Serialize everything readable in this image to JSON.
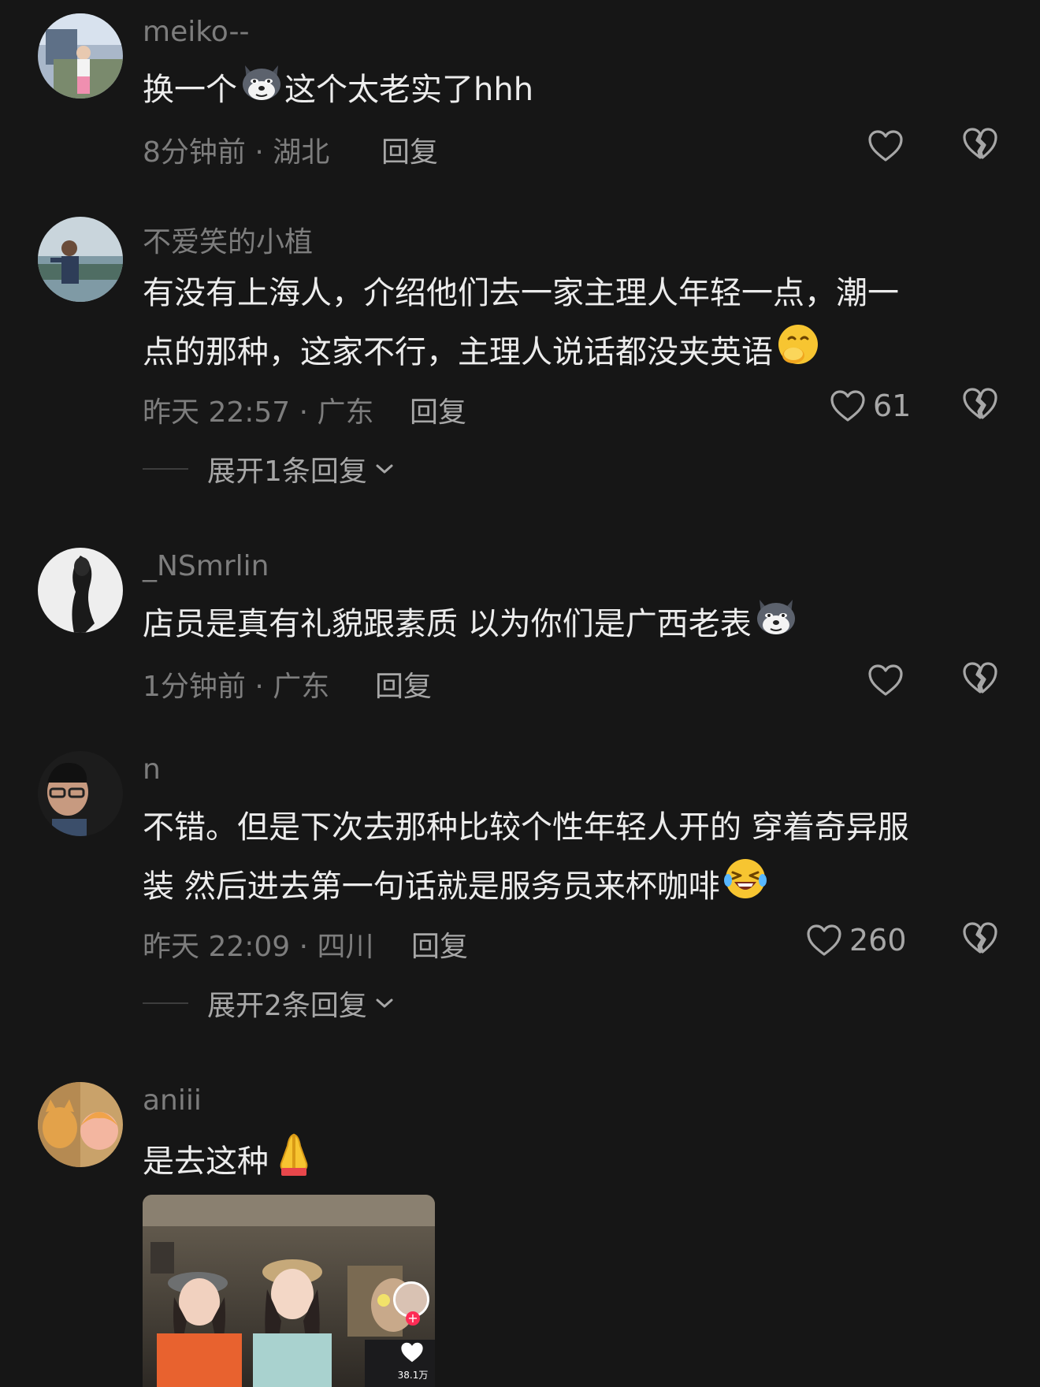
{
  "colors": {
    "background": "#161616",
    "primary_text": "#ececec",
    "secondary_text": "#7d7d7d",
    "action_text": "#a7a7a7"
  },
  "comments": [
    {
      "username": "meiko--",
      "text_lines": [
        "换一个",
        "这个太老实了hhh"
      ],
      "emoji": "husky-sticker",
      "meta": "8分钟前 · 湖北",
      "reply_label": "回复",
      "like_count": "",
      "like_icon": "heart-outline-icon",
      "dislike_icon": "broken-heart-icon"
    },
    {
      "username": "不爱笑的小植",
      "text_lines": [
        "有没有上海人，介绍他们去一家主理人年轻一点，潮一",
        "点的那种，这家不行，主理人说话都没夹英语"
      ],
      "emoji": "covering-mouth-smile-emoji",
      "meta": "昨天 22:57 · 广东",
      "reply_label": "回复",
      "like_count": "61",
      "expand_label": "展开1条回复"
    },
    {
      "username": "_NSmrlin",
      "text_lines": [
        "店员是真有礼貌跟素质  以为你们是广西老表"
      ],
      "emoji": "husky-sticker",
      "meta": "1分钟前 · 广东",
      "reply_label": "回复",
      "like_count": ""
    },
    {
      "username": "n",
      "text_lines": [
        "不错。但是下次去那种比较个性年轻人开的 穿着奇异服",
        "装 然后进去第一句话就是服务员来杯咖啡"
      ],
      "emoji": "rolling-laughing-emoji",
      "meta": "昨天 22:09 · 四川",
      "reply_label": "回复",
      "like_count": "260",
      "expand_label": "展开2条回复"
    },
    {
      "username": "aniii",
      "text_lines": [
        "是去这种"
      ],
      "emoji": "folded-hands-emoji",
      "attached_video": {
        "like_count": "38.1万",
        "follow_plus": "+"
      }
    }
  ]
}
